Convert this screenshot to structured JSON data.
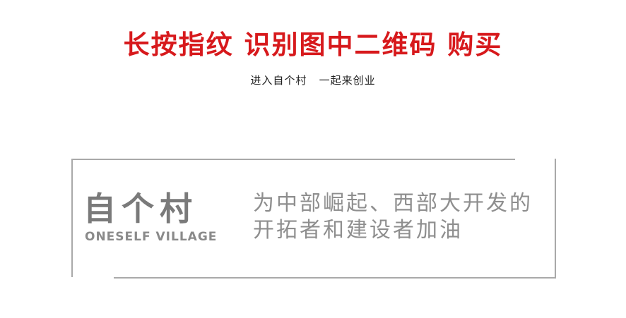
{
  "headline": "长按指纹 识别图中二维码 购买",
  "subline": "进入自个村   一起来创业",
  "logo": {
    "mark_text": "自个村",
    "english_name": "ONESELF VILLAGE"
  },
  "slogan": {
    "line1": "为中部崛起、西部大开发的",
    "line2": "开拓者和建设者加油"
  },
  "colors": {
    "headline": "#d7191c",
    "subline": "#222222",
    "frame": "#a9a9a9",
    "logo": "#7a7a7a",
    "slogan": "#8e8e8e"
  }
}
